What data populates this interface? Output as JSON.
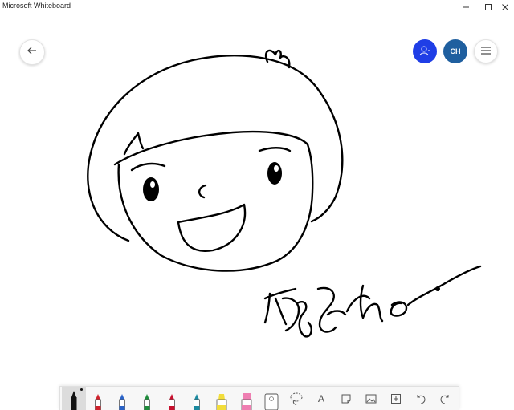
{
  "window": {
    "title": "Microsoft Whiteboard",
    "controls": [
      "minimize-icon",
      "maximize-icon",
      "close-icon"
    ]
  },
  "header": {
    "back_icon": "arrow-left-icon",
    "invite_icon": "person-add-icon",
    "user_initials": "CH",
    "menu_icon": "hamburger-icon"
  },
  "colors": {
    "invite_bg": "#1f3ee6",
    "avatar_bg": "#1f5f9f",
    "ink": "#000000"
  },
  "toolbar": {
    "tools": [
      {
        "name": "pen-black",
        "color": "#111111",
        "active": true
      },
      {
        "name": "pen-red",
        "color": "#d0222c"
      },
      {
        "name": "pen-blue",
        "color": "#2a63c8"
      },
      {
        "name": "pen-green",
        "color": "#1e8c3c"
      },
      {
        "name": "pen-red-2",
        "color": "#c8102e"
      },
      {
        "name": "pen-teal",
        "color": "#1b8aa0"
      },
      {
        "name": "highlighter-yellow",
        "color": "#f2dd3a"
      },
      {
        "name": "highlighter-pink",
        "color": "#ef7fb2"
      },
      {
        "name": "eraser",
        "color": "#888888"
      },
      {
        "name": "lasso-select",
        "color": "#555555"
      },
      {
        "name": "text-tool",
        "label": "A"
      },
      {
        "name": "sticky-note",
        "color": "#555555"
      },
      {
        "name": "insert-image",
        "color": "#555555"
      },
      {
        "name": "add-content",
        "color": "#555555"
      },
      {
        "name": "undo",
        "color": "#555555"
      },
      {
        "name": "redo",
        "color": "#555555"
      }
    ]
  }
}
